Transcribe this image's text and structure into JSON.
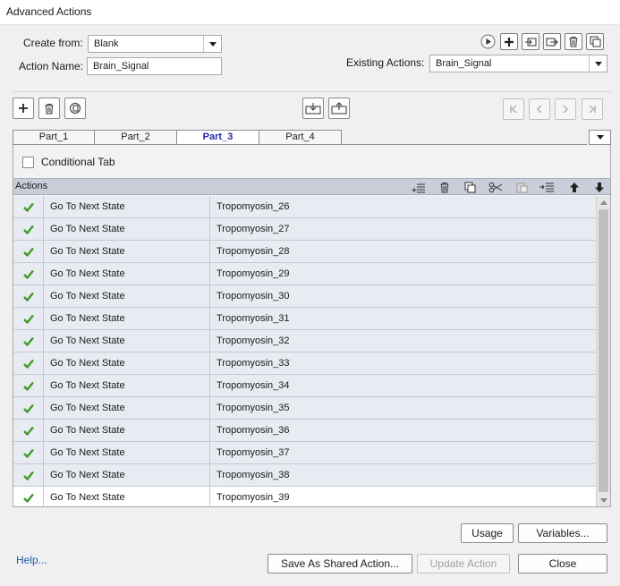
{
  "window": {
    "title": "Advanced Actions"
  },
  "form": {
    "create_from_label": "Create from:",
    "create_from_value": "Blank",
    "action_name_label": "Action Name:",
    "action_name_value": "Brain_Signal",
    "existing_label": "Existing Actions:",
    "existing_value": "Brain_Signal"
  },
  "tabs": [
    {
      "label": "Part_1",
      "active": false
    },
    {
      "label": "Part_2",
      "active": false
    },
    {
      "label": "Part_3",
      "active": true
    },
    {
      "label": "Part_4",
      "active": false
    }
  ],
  "conditional": {
    "label": "Conditional Tab",
    "checked": false
  },
  "grid": {
    "caption": "Actions",
    "rows": [
      {
        "action": "Go To Next State",
        "target": "Tropomyosin_26"
      },
      {
        "action": "Go To Next State",
        "target": "Tropomyosin_27"
      },
      {
        "action": "Go To Next State",
        "target": "Tropomyosin_28"
      },
      {
        "action": "Go To Next State",
        "target": "Tropomyosin_29"
      },
      {
        "action": "Go To Next State",
        "target": "Tropomyosin_30"
      },
      {
        "action": "Go To Next State",
        "target": "Tropomyosin_31"
      },
      {
        "action": "Go To Next State",
        "target": "Tropomyosin_32"
      },
      {
        "action": "Go To Next State",
        "target": "Tropomyosin_33"
      },
      {
        "action": "Go To Next State",
        "target": "Tropomyosin_34"
      },
      {
        "action": "Go To Next State",
        "target": "Tropomyosin_35"
      },
      {
        "action": "Go To Next State",
        "target": "Tropomyosin_36"
      },
      {
        "action": "Go To Next State",
        "target": "Tropomyosin_37"
      },
      {
        "action": "Go To Next State",
        "target": "Tropomyosin_38"
      },
      {
        "action": "Go To Next State",
        "target": "Tropomyosin_39"
      }
    ]
  },
  "buttons": {
    "usage": "Usage",
    "variables": "Variables...",
    "help": "Help...",
    "save_shared": "Save As Shared Action...",
    "update_action": "Update Action",
    "close": "Close"
  },
  "colors": {
    "check_green": "#3f9a2a",
    "active_tab_text": "#1f2aa8",
    "link": "#1c5aa6",
    "grid_header": "#c9ced8"
  },
  "icons": {
    "top_right": [
      "preview-icon",
      "add-icon",
      "import-icon",
      "export-icon",
      "delete-icon",
      "duplicate-icon"
    ],
    "left_tools": [
      "add-icon",
      "delete-icon",
      "duplicate-icon"
    ],
    "grid_tools": [
      "insert-row-icon",
      "delete-row-icon",
      "copy-row-icon",
      "cut-icon",
      "paste-icon",
      "insert-below-icon",
      "move-up-icon",
      "move-down-icon"
    ]
  }
}
